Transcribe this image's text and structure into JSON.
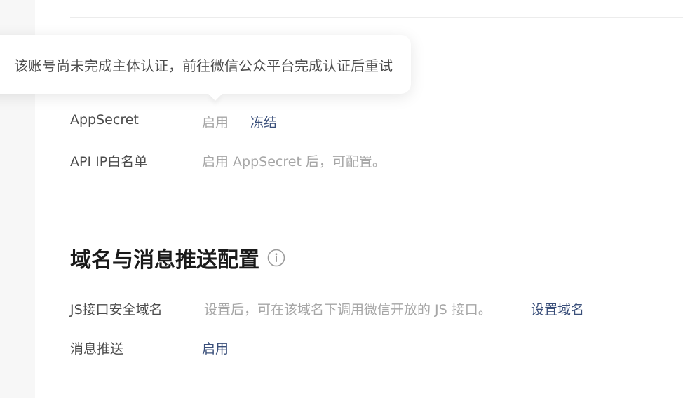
{
  "tooltip": {
    "text": "该账号尚未完成主体认证，前往微信公众平台完成认证后重试"
  },
  "dev_info": {
    "appsecret_row": {
      "label": "AppSecret",
      "status": "启用",
      "action": "冻结"
    },
    "ip_whitelist_row": {
      "label": "API IP白名单",
      "hint": "启用 AppSecret 后，可配置。"
    }
  },
  "domain_section": {
    "title": "域名与消息推送配置",
    "info_icon": "info-circle-icon",
    "js_domain_row": {
      "label": "JS接口安全域名",
      "hint": "设置后，可在该域名下调用微信开放的 JS 接口。",
      "action": "设置域名"
    },
    "push_row": {
      "label": "消息推送",
      "action": "启用"
    }
  },
  "colors": {
    "link": "#3a4f7a",
    "muted": "#a6a6a6",
    "label": "#4c4c4c",
    "title": "#1a1a1a"
  }
}
